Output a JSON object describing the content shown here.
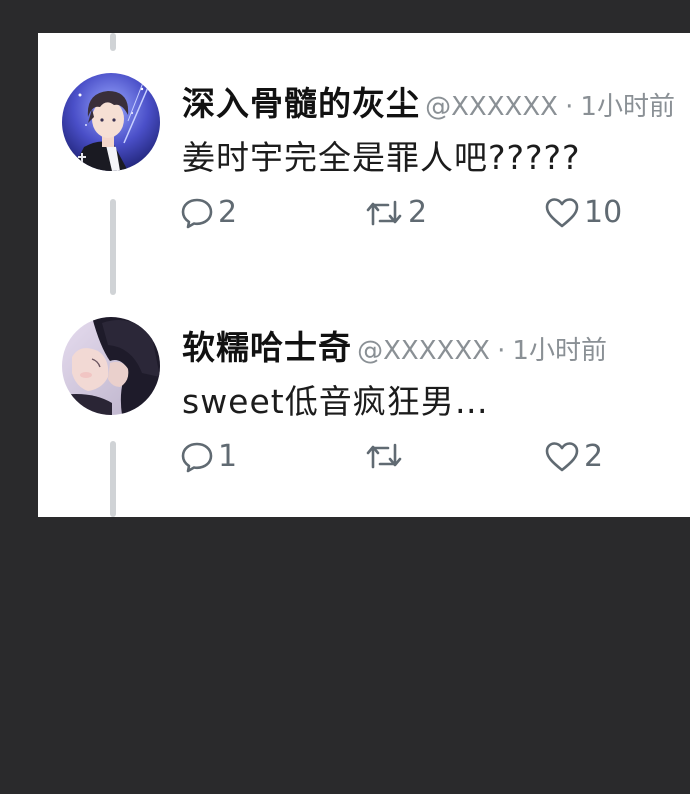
{
  "tweets": [
    {
      "name": "深入骨髓的灰尘",
      "handle": "@XXXXXX",
      "separator": "·",
      "time": "1小时前",
      "text": "姜时宇完全是罪人吧?????",
      "replies": "2",
      "retweets": "2",
      "likes": "10",
      "avatar_icon": "anime-boy-blue-night-avatar"
    },
    {
      "name": "软糯哈士奇",
      "handle": "@XXXXXX",
      "separator": "·",
      "time": "1小时前",
      "text": "sweet低音疯狂男…",
      "replies": "1",
      "retweets": "",
      "likes": "2",
      "avatar_icon": "anime-couple-embrace-avatar"
    }
  ],
  "colors": {
    "background": "#2a2a2c",
    "card": "#ffffff",
    "icon_gray": "#606a72",
    "handle_gray": "#8a9095",
    "thread_line": "#d0d3d6"
  }
}
